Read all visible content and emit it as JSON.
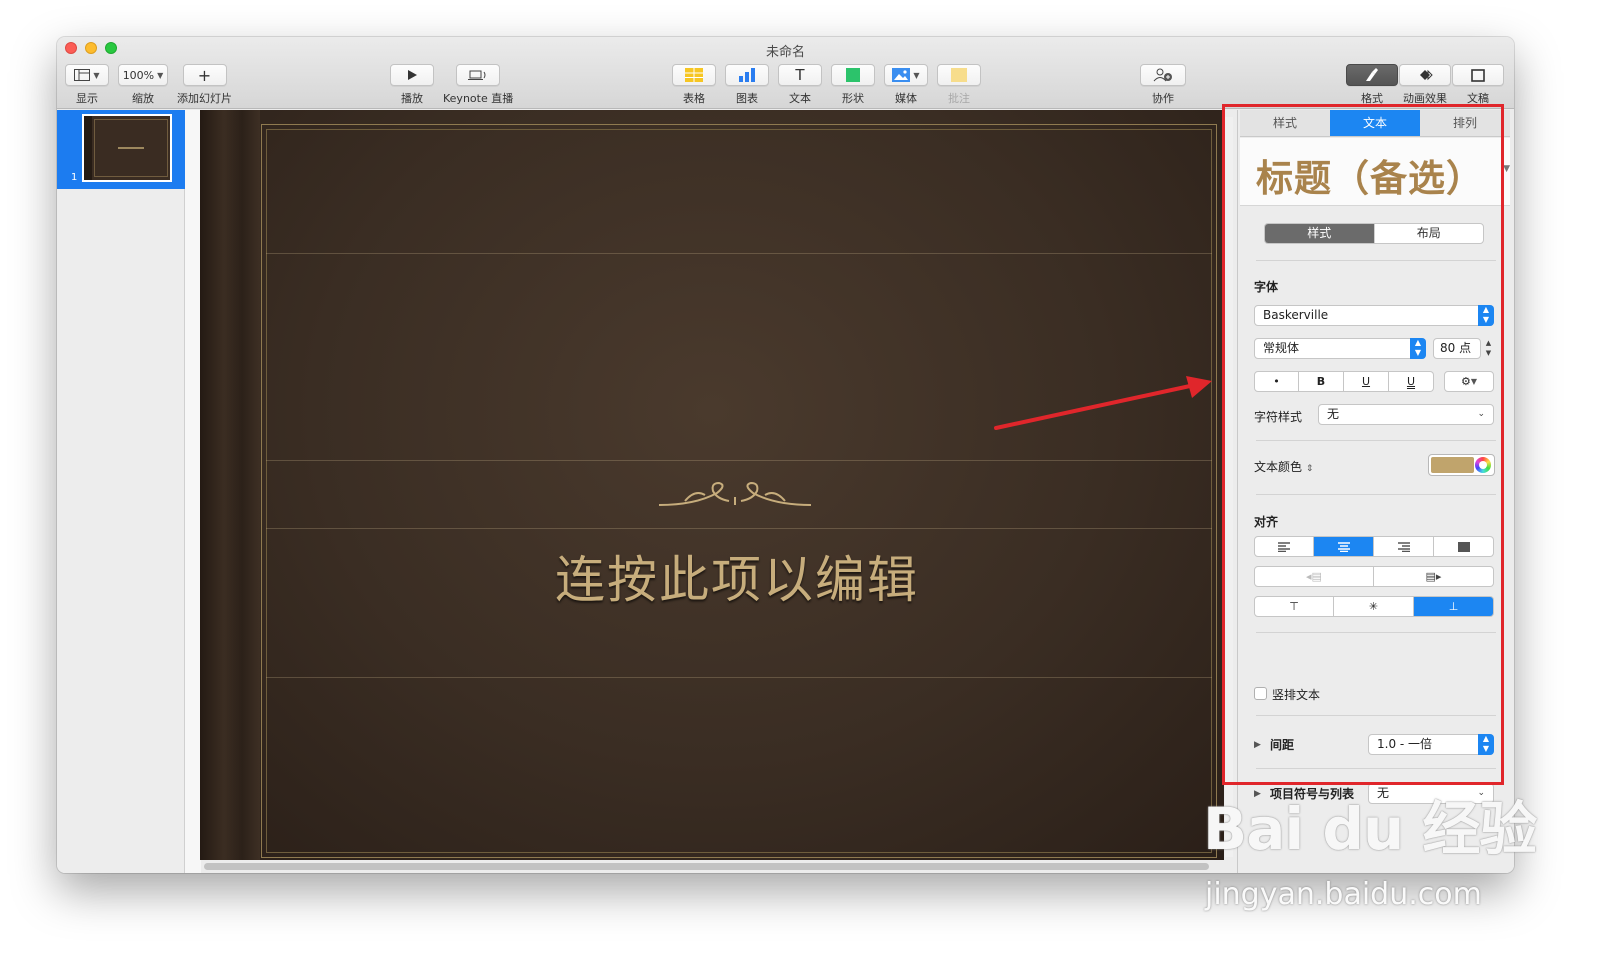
{
  "window": {
    "title": "未命名"
  },
  "toolbar": {
    "view_label": "显示",
    "zoom_value": "100%",
    "zoom_label": "缩放",
    "add_slide_label": "添加幻灯片",
    "play_label": "播放",
    "keynote_live_label": "Keynote 直播",
    "table_label": "表格",
    "chart_label": "图表",
    "text_button_glyph": "T",
    "text_label": "文本",
    "shape_label": "形状",
    "media_label": "媒体",
    "comment_label": "批注",
    "collaborate_label": "协作",
    "format_label": "格式",
    "animate_label": "动画效果",
    "document_label": "文稿"
  },
  "navigator": {
    "slides": [
      {
        "number": "1"
      }
    ]
  },
  "slide": {
    "title_text": "连按此项以编辑"
  },
  "inspector": {
    "tabs": [
      "样式",
      "文本",
      "排列"
    ],
    "active_tab": "文本",
    "paragraph_style_preview": "标题（备选）",
    "subtabs": [
      "样式",
      "布局"
    ],
    "font_section_label": "字体",
    "font_family": "Baskerville",
    "font_typeface": "常规体",
    "font_size": "80 点",
    "format_buttons": [
      "•",
      "B",
      "U",
      "U"
    ],
    "char_style_label": "字符样式",
    "char_style_value": "无",
    "text_color_label": "文本颜色",
    "text_color": "#c0a46c",
    "alignment_label": "对齐",
    "vertical_text_label": "竖排文本",
    "spacing_label": "间距",
    "spacing_value": "1.0 - 一倍",
    "bullets_label": "项目符号与列表",
    "bullets_value": "无"
  },
  "watermark": {
    "logo": "Bai du 经验",
    "url": "jingyan.baidu.com"
  },
  "colors": {
    "accent": "#1c86f2",
    "annotation": "#e0262b",
    "slide_gold": "#c7ad7c"
  }
}
